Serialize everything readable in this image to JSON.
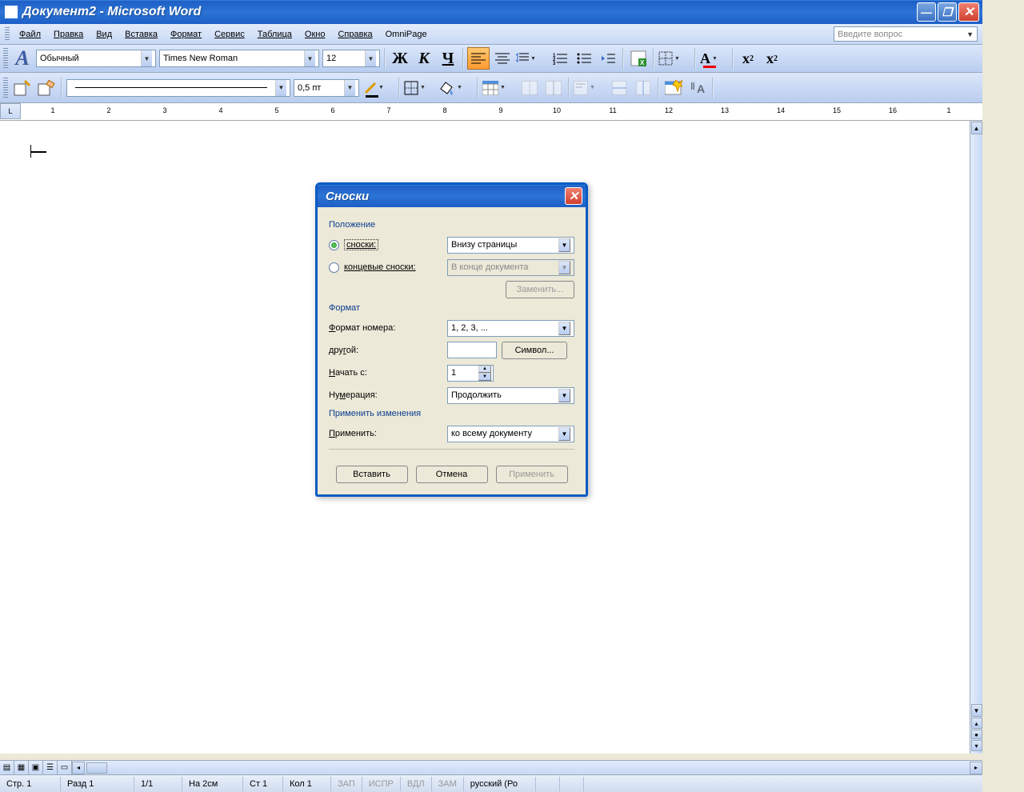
{
  "titlebar": {
    "text": "Документ2 - Microsoft Word"
  },
  "menus": {
    "file": "Файл",
    "edit": "Правка",
    "view": "Вид",
    "insert": "Вставка",
    "format": "Формат",
    "tools": "Сервис",
    "table": "Таблица",
    "window": "Окно",
    "help": "Справка",
    "omnipage": "OmniPage"
  },
  "help_search_placeholder": "Введите вопрос",
  "toolbar": {
    "style": "Обычный",
    "font": "Times New Roman",
    "size": "12",
    "bold": "Ж",
    "italic": "К",
    "underline": "Ч",
    "line_weight": "0,5 пт"
  },
  "dialog": {
    "title": "Сноски",
    "position": {
      "group": "Положение",
      "footnotes_label": "сноски:",
      "footnotes_value": "Внизу страницы",
      "endnotes_label": "концевые сноски:",
      "endnotes_value": "В конце документа",
      "replace": "Заменить..."
    },
    "format": {
      "group": "Формат",
      "number_format_label": "Формат номера:",
      "number_format_value": "1, 2, 3, ...",
      "other_label": "другой:",
      "symbol_btn": "Символ...",
      "start_at_label": "Начать с:",
      "start_at_value": "1",
      "numbering_label": "Нумерация:",
      "numbering_value": "Продолжить"
    },
    "apply": {
      "group": "Применить изменения",
      "apply_label": "Применить:",
      "apply_value": "ко всему документу"
    },
    "buttons": {
      "insert": "Вставить",
      "cancel": "Отмена",
      "apply": "Применить"
    }
  },
  "statusbar": {
    "page": "Стр. 1",
    "section": "Разд 1",
    "pages": "1/1",
    "at": "На 2см",
    "line": "Ст 1",
    "col": "Кол 1",
    "rec": "ЗАП",
    "trk": "ИСПР",
    "ext": "ВДЛ",
    "ovr": "ЗАМ",
    "lang": "русский (Ро"
  },
  "ruler_numbers": [
    "1",
    "2",
    "3",
    "4",
    "5",
    "6",
    "7",
    "8",
    "9",
    "10",
    "11",
    "12",
    "13",
    "14",
    "15",
    "16",
    "1"
  ]
}
